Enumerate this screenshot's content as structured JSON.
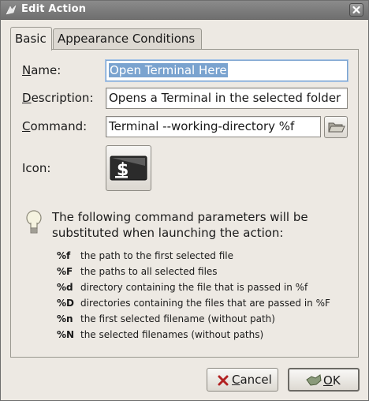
{
  "window": {
    "title": "Edit Action"
  },
  "tabs": [
    {
      "label": "Basic",
      "active": true
    },
    {
      "label": "Appearance Conditions",
      "active": false
    }
  ],
  "form": {
    "name": {
      "mnemonic": "N",
      "rest": "ame:",
      "value": "Open Terminal Here"
    },
    "description": {
      "mnemonic": "D",
      "rest": "escription:",
      "value": "Opens a Terminal in the selected folder"
    },
    "command": {
      "mnemonic": "C",
      "rest": "ommand:",
      "value": "Terminal --working-directory %f"
    },
    "icon": {
      "label": "Icon:",
      "icon_name": "terminal-icon"
    }
  },
  "info": {
    "intro": "The following command parameters will be substituted when launching the action:",
    "params": [
      {
        "code": "%f",
        "desc": "the path to the first selected file"
      },
      {
        "code": "%F",
        "desc": "the paths to all selected files"
      },
      {
        "code": "%d",
        "desc": "directory containing the file that is passed in %f"
      },
      {
        "code": "%D",
        "desc": "directories containing the files that are passed in %F"
      },
      {
        "code": "%n",
        "desc": "the first selected filename (without path)"
      },
      {
        "code": "%N",
        "desc": "the selected filenames (without paths)"
      }
    ]
  },
  "buttons": {
    "cancel": {
      "mnemonic": "C",
      "rest": "ancel"
    },
    "ok": {
      "mnemonic": "O",
      "rest": "K"
    }
  },
  "colors": {
    "selection": "#7aa3cf",
    "window_bg": "#ede9e3",
    "titlebar": "#7d7d7d"
  }
}
